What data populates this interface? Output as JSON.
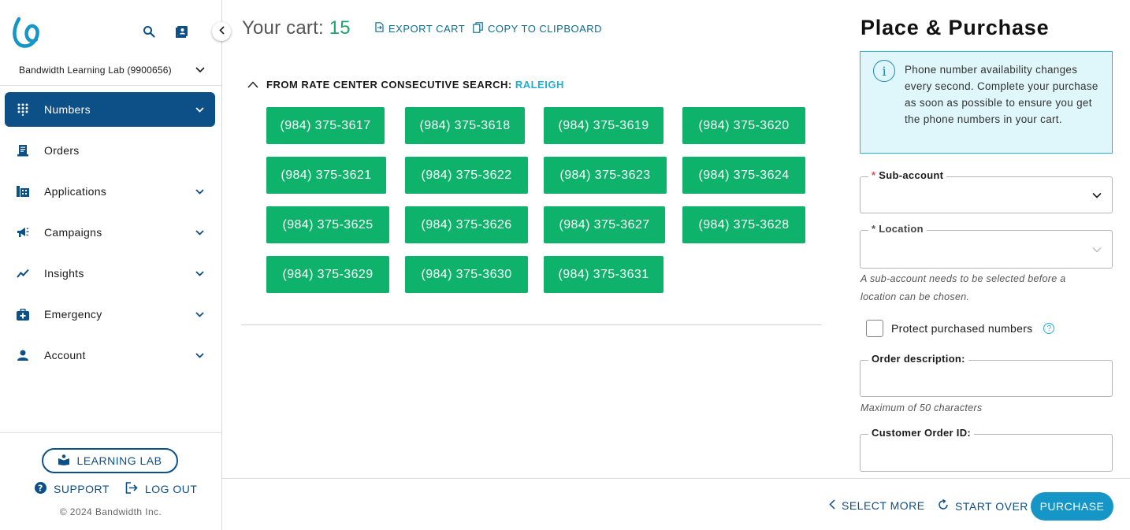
{
  "sidebar": {
    "account_name": "Bandwidth Learning Lab (9900656)",
    "nav": [
      {
        "label": "Numbers",
        "icon": "dialpad-icon",
        "active": true,
        "chevron": true
      },
      {
        "label": "Orders",
        "icon": "orders-icon",
        "active": false,
        "chevron": false
      },
      {
        "label": "Applications",
        "icon": "applications-icon",
        "active": false,
        "chevron": true
      },
      {
        "label": "Campaigns",
        "icon": "megaphone-icon",
        "active": false,
        "chevron": true
      },
      {
        "label": "Insights",
        "icon": "chart-line-icon",
        "active": false,
        "chevron": true
      },
      {
        "label": "Emergency",
        "icon": "medical-kit-icon",
        "active": false,
        "chevron": true
      },
      {
        "label": "Account",
        "icon": "person-icon",
        "active": false,
        "chevron": true
      }
    ],
    "learning_lab": "LEARNING LAB",
    "support": "SUPPORT",
    "logout": "LOG OUT",
    "copyright": "© 2024 Bandwidth Inc."
  },
  "cart": {
    "title": "Your cart:",
    "count": "15",
    "export": "EXPORT CART",
    "copy": "COPY TO CLIPBOARD",
    "group_label": "FROM RATE CENTER CONSECUTIVE SEARCH:",
    "group_city": "RALEIGH",
    "numbers": [
      "(984) 375-3617",
      "(984) 375-3618",
      "(984) 375-3619",
      "(984) 375-3620",
      "(984) 375-3621",
      "(984) 375-3622",
      "(984) 375-3623",
      "(984) 375-3624",
      "(984) 375-3625",
      "(984) 375-3626",
      "(984) 375-3627",
      "(984) 375-3628",
      "(984) 375-3629",
      "(984) 375-3630",
      "(984) 375-3631"
    ]
  },
  "purchase_panel": {
    "title": "Place & Purchase",
    "info": "Phone number availability changes every second. Complete your purchase as soon as possible to ensure you get the phone numbers in your cart.",
    "subaccount_label": "Sub-account",
    "location_label": "Location",
    "location_help": "A sub-account needs to be selected before a location can be chosen.",
    "protect_label": "Protect purchased numbers",
    "order_desc_label": "Order description:",
    "order_desc_help": "Maximum of 50 characters",
    "customer_order_label": "Customer Order ID:"
  },
  "footer": {
    "select_more": "SELECT MORE",
    "start_over": "START OVER",
    "purchase": "PURCHASE"
  },
  "colors": {
    "primary": "#0d4f87",
    "number_chip": "#0fb26b",
    "accent": "#1ab0d8",
    "purchase": "#1596c6"
  }
}
